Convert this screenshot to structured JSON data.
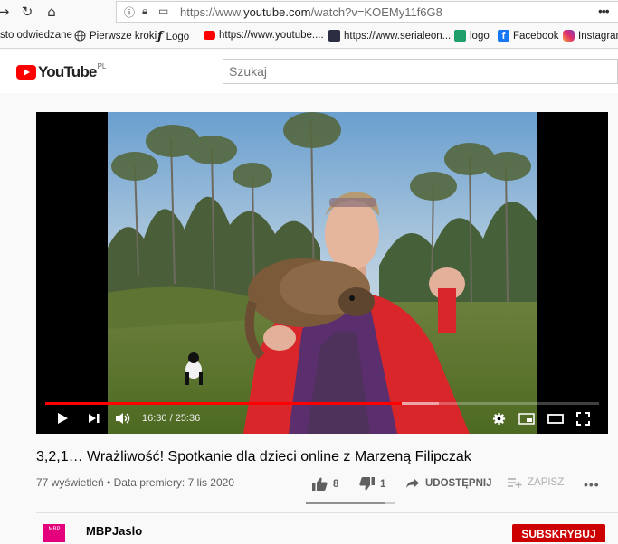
{
  "browser": {
    "url_prefix": "https://www.",
    "url_domain": "youtube.com",
    "url_path": "/watch?v=KOEMy11f6G8",
    "more_label": "•••"
  },
  "bookmarks": [
    {
      "label": "sto odwiedzane",
      "icon": "none"
    },
    {
      "label": "Pierwsze kroki",
      "icon": "globe-icon"
    },
    {
      "label": "Logo",
      "icon": "logo-icon"
    },
    {
      "label": "https://www.youtube....",
      "icon": "youtube-icon"
    },
    {
      "label": "https://www.serialeon...",
      "icon": "serialeon-icon"
    },
    {
      "label": "logo",
      "icon": "logo-green-icon"
    },
    {
      "label": "Facebook",
      "icon": "facebook-icon"
    },
    {
      "label": "Instagram",
      "icon": "instagram-icon"
    }
  ],
  "header": {
    "logo_text": "YouTube",
    "country_code": "PL",
    "search_placeholder": "Szukaj"
  },
  "player": {
    "current_time": "16:30",
    "duration": "25:36",
    "time_display": "16:30 / 25:36",
    "progress_fraction": 0.6445,
    "buffered_fraction": 0.71
  },
  "video": {
    "title": "3,2,1… Wrażliwość! Spotkanie dla dzieci online z Marzeną Filipczak",
    "views": "77 wyświetleń",
    "premiere": "Data premiery: 7 lis 2020",
    "meta_separator": " • ",
    "likes": "8",
    "dislikes": "1",
    "share_label": "UDOSTĘPNIJ",
    "save_label": "ZAPISZ",
    "like_ratio": 0.889
  },
  "channel": {
    "name": "MBPJaslo",
    "avatar_text": "MBP",
    "subscribe_label": "SUBSKRYBUJ"
  },
  "colors": {
    "youtube_red": "#ff0000",
    "subscribe_red": "#cc0000",
    "facebook_blue": "#1877f2"
  }
}
